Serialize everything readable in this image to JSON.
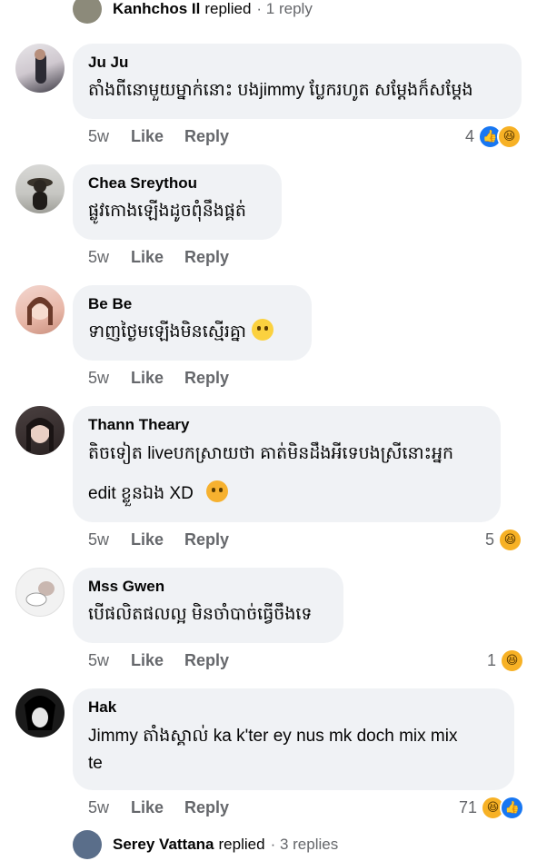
{
  "top_reply": {
    "name": "Kanhchos Il",
    "replied": "replied",
    "count": "· 1 reply"
  },
  "bottom_reply": {
    "name": "Serey Vattana",
    "replied": "replied",
    "count": "· 3 replies"
  },
  "labels": {
    "like": "Like",
    "reply": "Reply"
  },
  "comments": [
    {
      "author": "Ju Ju",
      "text": "តាំងពីនោមួយម្នាក់នោះ បងjimmy ប្លែករហូត សម្ដែងក៏សម្ដែង",
      "time": "5w",
      "reactions": {
        "count": "4",
        "icons": [
          "like-icon",
          "haha-icon"
        ]
      }
    },
    {
      "author": "Chea Sreythou",
      "text": "ផ្លូវកោងឡើងដូចពុំនឹងផ្គត់",
      "time": "5w"
    },
    {
      "author": "Be Be",
      "text": "ទាញថ្ងៃមឡើងមិនស្មើរគ្នា",
      "emoji": "laughing-crying-emoji",
      "time": "5w"
    },
    {
      "author": "Thann Theary",
      "text": "តិចទៀត liveបកស្រាយថា គាត់មិនដឹងអីទេបងស្រីនោះអ្នក",
      "text2": "edit ខ្លួនឯង XD",
      "emoji": "yawning-emoji",
      "time": "5w",
      "reactions": {
        "count": "5",
        "icons": [
          "haha-icon"
        ]
      }
    },
    {
      "author": "Mss Gwen",
      "text": "បើផលិតផលល្អ មិនចាំបាច់ធ្វើចឹងទេ",
      "time": "5w",
      "reactions": {
        "count": "1",
        "icons": [
          "haha-icon"
        ]
      }
    },
    {
      "author": "Hak",
      "text": "Jimmy តាំងស្គាល់ ka k'ter ey nus mk doch mix mix",
      "text2": "te",
      "time": "5w",
      "reactions": {
        "count": "71",
        "icons": [
          "haha-icon",
          "like-icon"
        ]
      }
    }
  ],
  "colors": {
    "bubble": "#f0f2f5",
    "meta": "#65676b",
    "like": "#1877f2",
    "haha": "#f7b125"
  }
}
